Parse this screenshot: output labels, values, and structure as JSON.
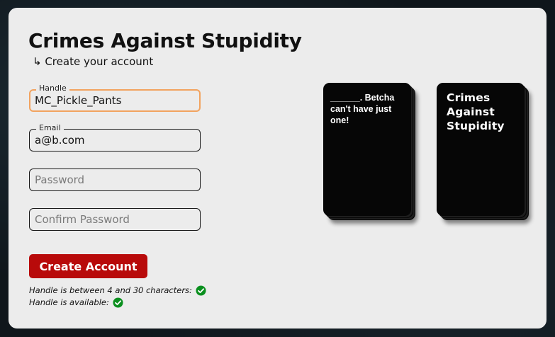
{
  "page": {
    "title": "Crimes Against Stupidity",
    "subtitle": "↳ Create your account"
  },
  "form": {
    "handle": {
      "label": "Handle",
      "value": "MC_Pickle_Pants",
      "placeholder": ""
    },
    "email": {
      "label": "Email",
      "value": "a@b.com",
      "placeholder": ""
    },
    "password": {
      "label": "",
      "value": "",
      "placeholder": "Password"
    },
    "confirm_password": {
      "label": "",
      "value": "",
      "placeholder": "Confirm Password"
    },
    "submit_label": "Create Account",
    "focus_color": "#f2a35f",
    "button_color": "#b80a0a"
  },
  "validation": [
    {
      "text": "Handle is between 4 and 30 characters:",
      "status": "ok",
      "icon": "check-circle-icon",
      "color": "#0a8f1e"
    },
    {
      "text": "Handle is available:",
      "status": "ok",
      "icon": "check-circle-icon",
      "color": "#0a8f1e"
    }
  ],
  "cards": {
    "black_card_text": "______. Betcha can't have just one!",
    "brand_card_text": "Crimes\nAgainst\nStupidity"
  }
}
